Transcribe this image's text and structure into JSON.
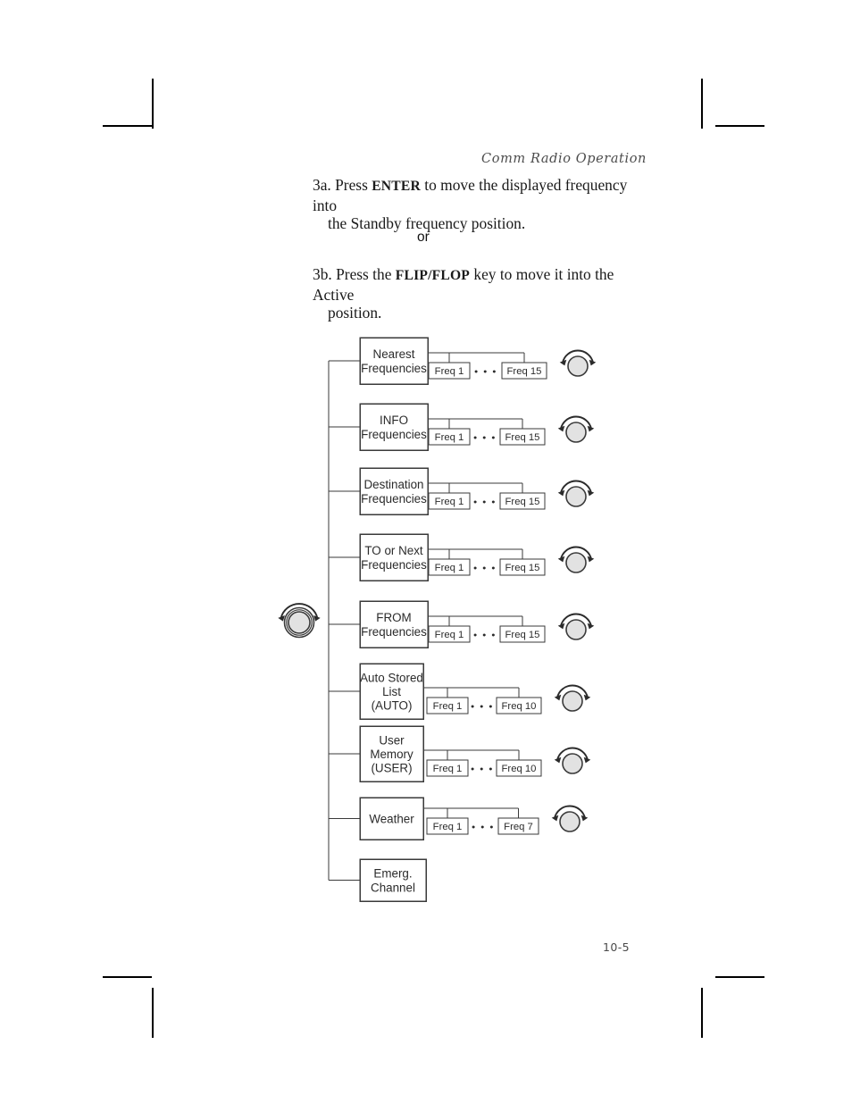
{
  "page": {
    "running_header": "Comm Radio Operation",
    "folio": "10-5"
  },
  "steps": {
    "step_3a": {
      "number": "3a.",
      "text_before": "Press",
      "keycap": "ENTER",
      "text_after": "to move the displayed frequency into",
      "continuation": "the Standby frequency position."
    },
    "connector": "or",
    "step_3b": {
      "number": "3b.",
      "text_before": "Press the",
      "keycap": "FLIP/FLOP",
      "text_after": "key to move it into the Active",
      "continuation": "position."
    }
  },
  "diagram": {
    "knob_label": "concentric-knob",
    "ellipsis": "• • •",
    "rows": [
      {
        "id": "nearest",
        "lines": [
          "Nearest",
          "Frequencies"
        ],
        "first_freq": "Freq 1",
        "last_freq": "Freq 15",
        "has_knob": true
      },
      {
        "id": "info",
        "lines": [
          "INFO",
          "Frequencies"
        ],
        "first_freq": "Freq 1",
        "last_freq": "Freq 15",
        "has_knob": true
      },
      {
        "id": "destination",
        "lines": [
          "Destination",
          "Frequencies"
        ],
        "first_freq": "Freq 1",
        "last_freq": "Freq 15",
        "has_knob": true
      },
      {
        "id": "to-or-next",
        "lines": [
          "TO or Next",
          "Frequencies"
        ],
        "first_freq": "Freq 1",
        "last_freq": "Freq 15",
        "has_knob": true
      },
      {
        "id": "from",
        "lines": [
          "FROM",
          "Frequencies"
        ],
        "first_freq": "Freq 1",
        "last_freq": "Freq 15",
        "has_knob": true
      },
      {
        "id": "auto-stored-list",
        "lines": [
          "Auto Stored",
          "List",
          "(AUTO)"
        ],
        "first_freq": "Freq 1",
        "last_freq": "Freq 10",
        "has_knob": true
      },
      {
        "id": "user-memory",
        "lines": [
          "User",
          "Memory",
          "(USER)"
        ],
        "first_freq": "Freq 1",
        "last_freq": "Freq 10",
        "has_knob": true
      },
      {
        "id": "weather",
        "lines": [
          "Weather"
        ],
        "first_freq": "Freq 1",
        "last_freq": "Freq 7",
        "has_knob": true
      },
      {
        "id": "emergency-channel",
        "lines": [
          "Emerg.",
          "Channel"
        ],
        "first_freq": null,
        "last_freq": null,
        "has_knob": false
      }
    ]
  },
  "colors": {
    "ink": "#1a1a1a",
    "line": "#3a3a3a",
    "knob_fill": "#e2e2e2",
    "header_gray": "#4c4c4c"
  }
}
